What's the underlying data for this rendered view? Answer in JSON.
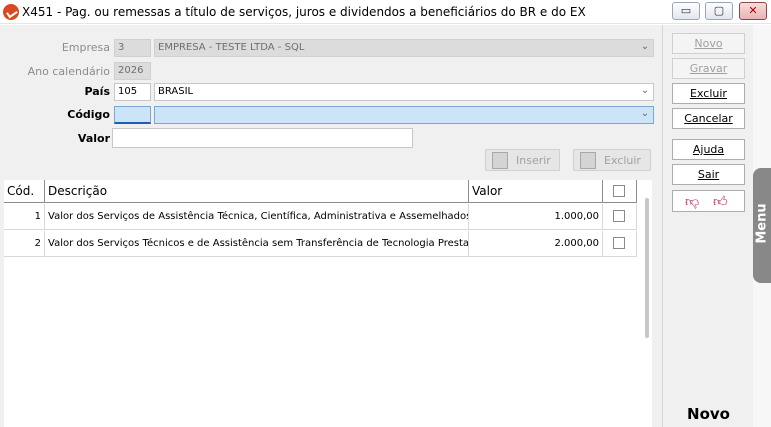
{
  "window": {
    "title": "X451 - Pag. ou remessas a título de serviços, juros e dividendos a beneficiários do BR e do EX",
    "minimize_glyph": "▭",
    "maximize_glyph": "▢",
    "close_glyph": "✕"
  },
  "form": {
    "empresa": {
      "label": "Empresa",
      "code": "3",
      "name": "EMPRESA - TESTE LTDA - SQL"
    },
    "ano": {
      "label": "Ano calendário",
      "value": "2026"
    },
    "pais": {
      "label": "País",
      "code": "105",
      "name": "BRASIL"
    },
    "codigo": {
      "label": "Código",
      "code": "",
      "name": ""
    },
    "valor": {
      "label": "Valor",
      "value": ""
    },
    "inserir_label": "Inserir",
    "excluir_label": "Excluir"
  },
  "grid": {
    "columns": [
      "Cód.",
      "Descrição",
      "Valor"
    ],
    "rows": [
      {
        "cod": "1",
        "descricao": "Valor dos Serviços de Assistência Técnica, Científica, Administrativa e Assemelhados con",
        "valor": "1.000,00",
        "checked": false
      },
      {
        "cod": "2",
        "descricao": "Valor dos Serviços Técnicos e de Assistência sem Transferência de Tecnologia Prestados",
        "valor": "2.000,00",
        "checked": false
      }
    ]
  },
  "sidebar": {
    "novo": "Novo",
    "gravar": "Gravar",
    "excluir": "Excluir",
    "cancelar": "Cancelar",
    "ajuda": "Ajuda",
    "sair": "Sair",
    "status": "Novo"
  },
  "menu_tab": "Menu",
  "colors": {
    "highlight_field": "#cce4f7",
    "app_icon": "#d9481f",
    "thumb": "#c2185b"
  }
}
